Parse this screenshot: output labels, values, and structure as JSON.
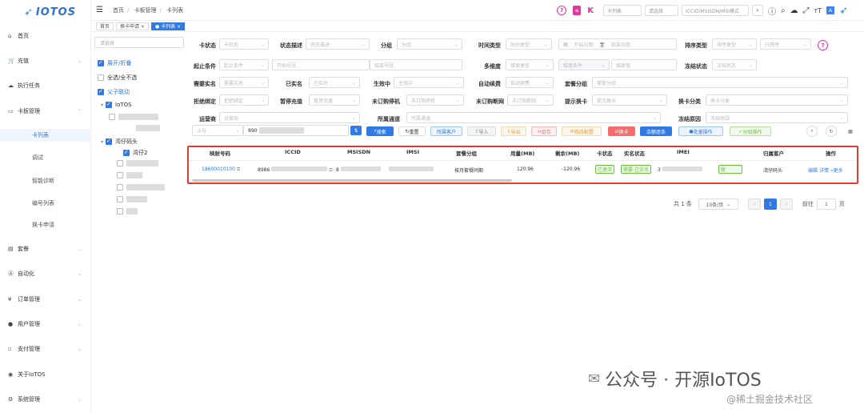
{
  "app": {
    "logo": "IOTOS"
  },
  "sidebar": {
    "items": [
      {
        "label": "首页",
        "icon": "home-icon"
      },
      {
        "label": "充值",
        "icon": "cart-icon"
      },
      {
        "label": "执行任务",
        "icon": "cloud-icon"
      },
      {
        "label": "卡板管理",
        "icon": "card-icon"
      },
      {
        "label": "套餐",
        "icon": "package-icon"
      },
      {
        "label": "自动化",
        "icon": "auto-icon"
      },
      {
        "label": "订单管理",
        "icon": "yen-icon"
      },
      {
        "label": "用户管理",
        "icon": "user-icon"
      },
      {
        "label": "支付管理",
        "icon": "pay-icon"
      },
      {
        "label": "关于IoTOS",
        "icon": "globe-icon"
      },
      {
        "label": "系统管理",
        "icon": "gear-icon"
      }
    ],
    "subitems": [
      "卡列表",
      "调试",
      "智能诊断",
      "编号列表",
      "换卡申请"
    ]
  },
  "header": {
    "breadcrumbs": [
      "首页",
      "卡板管理",
      "卡列表"
    ],
    "select_list": "卡列表",
    "select_type": "请选择",
    "search_placeholder": "ICCID/MSISDN/MSI模式"
  },
  "tags": [
    "首页",
    "换卡申请 ×",
    "● 卡列表 ×"
  ],
  "tree": {
    "search_placeholder": "请选择",
    "expand_label": "展开/折叠",
    "all_label": "全选/全不选",
    "linkage_label": "父子联动",
    "root": "IoTOS",
    "node1": "湾仔码头",
    "node2": "湾仔2"
  },
  "filters": {
    "card_status": {
      "label": "卡状态",
      "placeholder": "卡状态"
    },
    "status_desc": {
      "label": "状态描述",
      "placeholder": "状态描述"
    },
    "group": {
      "label": "分组",
      "placeholder": "分组"
    },
    "time_type": {
      "label": "时间类型",
      "placeholder": "时间类型"
    },
    "start_date": "开始日期",
    "to": "至",
    "end_date": "结束日期",
    "sort_type": {
      "label": "排序类型",
      "placeholder": "排序类型",
      "order": "升降序"
    },
    "start_cond": {
      "label": "起止条件",
      "placeholder": "起止条件",
      "start": "开始号段",
      "end": "结束号段"
    },
    "multi_dim": {
      "label": "多维度",
      "placeholder": "维度类型",
      "cond": "维度条件",
      "value": "维度值"
    },
    "freeze_status": {
      "label": "冻结状态",
      "placeholder": "冻结状态"
    },
    "realname_req": {
      "label": "需要实名",
      "placeholder": "需要实名"
    },
    "realname_done": {
      "label": "已实名",
      "placeholder": "已实名"
    },
    "active": {
      "label": "生效中",
      "placeholder": "生效中"
    },
    "auto_renew": {
      "label": "自动续费",
      "placeholder": "自动续费"
    },
    "pkg_group": {
      "label": "套餐分组",
      "placeholder": "套餐分组"
    },
    "bind": {
      "label": "拒绝绑定",
      "placeholder": "拒绝绑定"
    },
    "pause": {
      "label": "暂停充值",
      "placeholder": "暂停充值"
    },
    "unsub_machine": {
      "label": "未订购停机",
      "placeholder": "未订购停机"
    },
    "unsub_net": {
      "label": "未订购断网",
      "placeholder": "未订购断网"
    },
    "prompt_swap": {
      "label": "提示换卡",
      "placeholder": "提示换卡"
    },
    "swap_type": {
      "label": "换卡分类",
      "placeholder": "换卡分类"
    },
    "operator": {
      "label": "运营商",
      "placeholder": "运营商"
    },
    "channel": {
      "label": "所属通道",
      "placeholder": "所属通道"
    },
    "freeze_reason": {
      "label": "冻结原因",
      "placeholder": "冻结原因"
    },
    "card_type": "卡号",
    "card_value": "890"
  },
  "actions": [
    "搜索",
    "重置",
    "所属客户",
    "导入",
    "导出",
    "组合",
    "修改配置",
    "换卡",
    "余额逐条",
    "批量操作",
    "分组操作"
  ],
  "table": {
    "headers": [
      "映射号码",
      "ICCID",
      "MSISDN",
      "IMSI",
      "套餐分组",
      "用量(MB)",
      "剩余(MB)",
      "卡状态",
      "实名状态",
      "IMEI",
      "",
      "归属客户",
      "操作"
    ],
    "row": {
      "map_no": "18600010100",
      "iccid": "8986",
      "msisdn": "8",
      "group": "按月套餐同期",
      "used": "120.96",
      "remain": "-120.96",
      "status": "已激活",
      "realname": "需要-已实名",
      "imei": "3",
      "extra": "联",
      "customer": "湾仔码头",
      "ops": [
        "编辑",
        "详情",
        "更多"
      ]
    }
  },
  "pager": {
    "total": "共 1 条",
    "size": "10条/页",
    "page": "1",
    "goto": "前往",
    "goto_val": "1",
    "unit": "页"
  },
  "watermark": {
    "main": "公众号 · 开源IoTOS",
    "sub": "@稀土掘金技术社区"
  }
}
